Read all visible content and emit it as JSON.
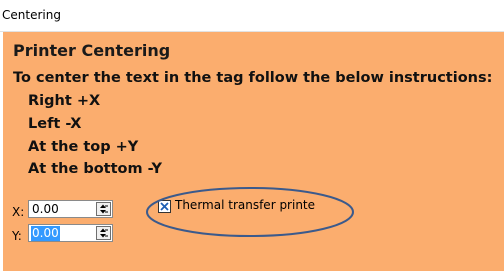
{
  "window": {
    "title": "Centering"
  },
  "panel": {
    "heading": "Printer Centering",
    "instruction": "To center the text in the tag follow the below instructions:",
    "steps": [
      "Right +X",
      "Left -X",
      "At the top +Y",
      "At the bottom -Y"
    ],
    "bg_color": "#fbad6e"
  },
  "fields": {
    "x": {
      "label": "X:",
      "value": "0.00"
    },
    "y": {
      "label": "Y:",
      "value": "0.00"
    }
  },
  "thermal_transfer": {
    "checked": true,
    "label": "Thermal transfer printe"
  },
  "annotation": {
    "color": "#3b5a8c",
    "shape": "ellipse"
  }
}
